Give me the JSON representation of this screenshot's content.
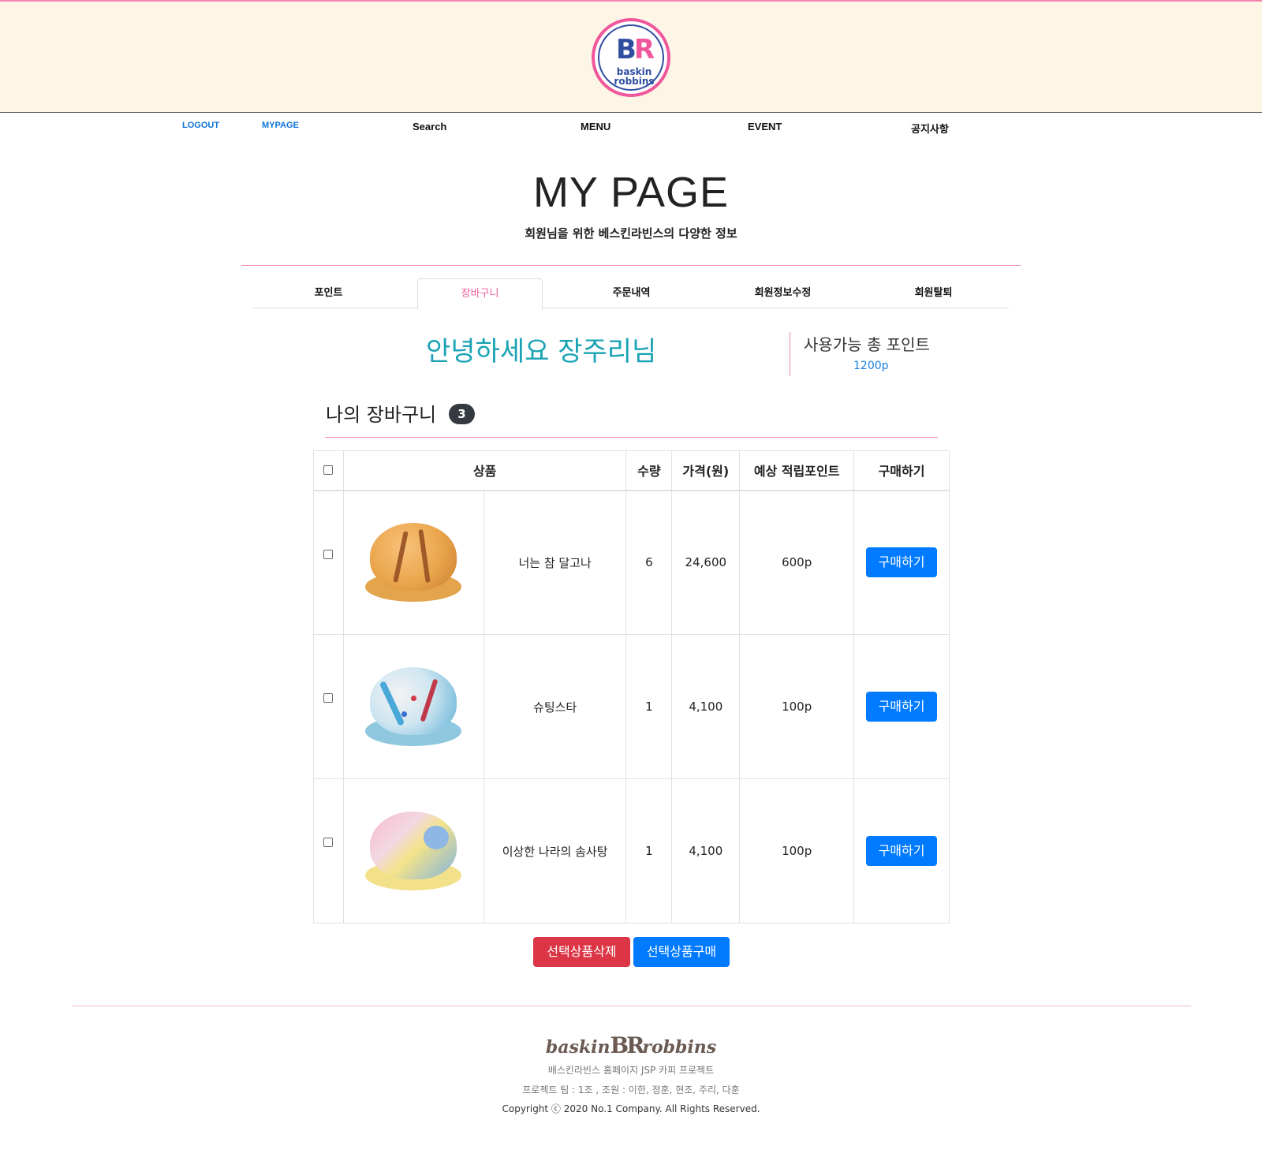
{
  "brand": {
    "logo_letters": "BR",
    "logo_text": "baskin robbins"
  },
  "nav": {
    "logout": "LOGOUT",
    "mypage": "MYPAGE",
    "search": "Search",
    "menu": "MENU",
    "event": "EVENT",
    "notice": "공지사항"
  },
  "page": {
    "title": "MY PAGE",
    "subtitle": "회원님을 위한 베스킨라빈스의 다양한 정보"
  },
  "tabs": [
    {
      "label": "포인트"
    },
    {
      "label": "장바구니",
      "active": true
    },
    {
      "label": "주문내역"
    },
    {
      "label": "회원정보수정"
    },
    {
      "label": "회원탈퇴"
    }
  ],
  "greeting": "안녕하세요 장주리님",
  "points": {
    "label": "사용가능 총 포인트",
    "value": "1200p"
  },
  "cart": {
    "title": "나의 장바구니",
    "count": "3",
    "headers": {
      "product": "상품",
      "qty": "수량",
      "price": "가격(원)",
      "points": "예상 적립포인트",
      "buy": "구매하기"
    },
    "items": [
      {
        "name": "너는 참 달고나",
        "qty": "6",
        "price": "24,600",
        "points": "600p",
        "buy": "구매하기"
      },
      {
        "name": "슈팅스타",
        "qty": "1",
        "price": "4,100",
        "points": "100p",
        "buy": "구매하기"
      },
      {
        "name": "이상한 나라의 솜사탕",
        "qty": "1",
        "price": "4,100",
        "points": "100p",
        "buy": "구매하기"
      }
    ],
    "delete_selected": "선택상품삭제",
    "buy_selected": "선택상품구매"
  },
  "footer": {
    "logo_left": "baskin",
    "logo_mid": "BR",
    "logo_right": "robbins",
    "line1": "배스킨라빈스 홈페이지 JSP 카피 프로젝트",
    "line2": "프로젝트 팀 : 1조 , 조원 : 이한, 정훈, 현조, 주리, 다훈",
    "copyright": "Copyright ⓒ 2020 No.1 Company. All Rights Reserved."
  },
  "colors": {
    "accent_pink": "#f386b3",
    "primary_blue": "#007bff",
    "danger_red": "#dc3545",
    "header_bg": "#fdf6e6",
    "greeting_teal": "#1aa3b5"
  }
}
